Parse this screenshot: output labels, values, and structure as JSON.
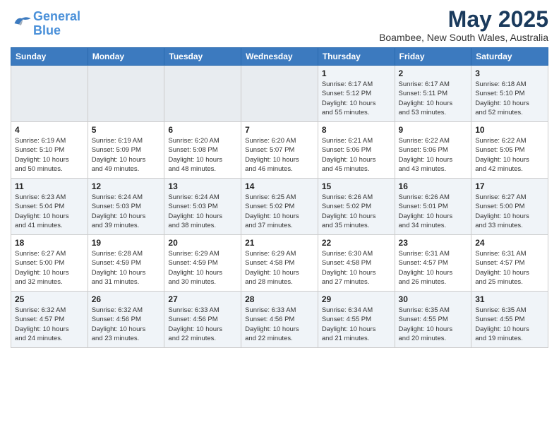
{
  "header": {
    "logo_line1": "General",
    "logo_line2": "Blue",
    "month_title": "May 2025",
    "location": "Boambee, New South Wales, Australia"
  },
  "weekdays": [
    "Sunday",
    "Monday",
    "Tuesday",
    "Wednesday",
    "Thursday",
    "Friday",
    "Saturday"
  ],
  "weeks": [
    [
      {
        "day": "",
        "info": ""
      },
      {
        "day": "",
        "info": ""
      },
      {
        "day": "",
        "info": ""
      },
      {
        "day": "",
        "info": ""
      },
      {
        "day": "1",
        "info": "Sunrise: 6:17 AM\nSunset: 5:12 PM\nDaylight: 10 hours\nand 55 minutes."
      },
      {
        "day": "2",
        "info": "Sunrise: 6:17 AM\nSunset: 5:11 PM\nDaylight: 10 hours\nand 53 minutes."
      },
      {
        "day": "3",
        "info": "Sunrise: 6:18 AM\nSunset: 5:10 PM\nDaylight: 10 hours\nand 52 minutes."
      }
    ],
    [
      {
        "day": "4",
        "info": "Sunrise: 6:19 AM\nSunset: 5:10 PM\nDaylight: 10 hours\nand 50 minutes."
      },
      {
        "day": "5",
        "info": "Sunrise: 6:19 AM\nSunset: 5:09 PM\nDaylight: 10 hours\nand 49 minutes."
      },
      {
        "day": "6",
        "info": "Sunrise: 6:20 AM\nSunset: 5:08 PM\nDaylight: 10 hours\nand 48 minutes."
      },
      {
        "day": "7",
        "info": "Sunrise: 6:20 AM\nSunset: 5:07 PM\nDaylight: 10 hours\nand 46 minutes."
      },
      {
        "day": "8",
        "info": "Sunrise: 6:21 AM\nSunset: 5:06 PM\nDaylight: 10 hours\nand 45 minutes."
      },
      {
        "day": "9",
        "info": "Sunrise: 6:22 AM\nSunset: 5:06 PM\nDaylight: 10 hours\nand 43 minutes."
      },
      {
        "day": "10",
        "info": "Sunrise: 6:22 AM\nSunset: 5:05 PM\nDaylight: 10 hours\nand 42 minutes."
      }
    ],
    [
      {
        "day": "11",
        "info": "Sunrise: 6:23 AM\nSunset: 5:04 PM\nDaylight: 10 hours\nand 41 minutes."
      },
      {
        "day": "12",
        "info": "Sunrise: 6:24 AM\nSunset: 5:03 PM\nDaylight: 10 hours\nand 39 minutes."
      },
      {
        "day": "13",
        "info": "Sunrise: 6:24 AM\nSunset: 5:03 PM\nDaylight: 10 hours\nand 38 minutes."
      },
      {
        "day": "14",
        "info": "Sunrise: 6:25 AM\nSunset: 5:02 PM\nDaylight: 10 hours\nand 37 minutes."
      },
      {
        "day": "15",
        "info": "Sunrise: 6:26 AM\nSunset: 5:02 PM\nDaylight: 10 hours\nand 35 minutes."
      },
      {
        "day": "16",
        "info": "Sunrise: 6:26 AM\nSunset: 5:01 PM\nDaylight: 10 hours\nand 34 minutes."
      },
      {
        "day": "17",
        "info": "Sunrise: 6:27 AM\nSunset: 5:00 PM\nDaylight: 10 hours\nand 33 minutes."
      }
    ],
    [
      {
        "day": "18",
        "info": "Sunrise: 6:27 AM\nSunset: 5:00 PM\nDaylight: 10 hours\nand 32 minutes."
      },
      {
        "day": "19",
        "info": "Sunrise: 6:28 AM\nSunset: 4:59 PM\nDaylight: 10 hours\nand 31 minutes."
      },
      {
        "day": "20",
        "info": "Sunrise: 6:29 AM\nSunset: 4:59 PM\nDaylight: 10 hours\nand 30 minutes."
      },
      {
        "day": "21",
        "info": "Sunrise: 6:29 AM\nSunset: 4:58 PM\nDaylight: 10 hours\nand 28 minutes."
      },
      {
        "day": "22",
        "info": "Sunrise: 6:30 AM\nSunset: 4:58 PM\nDaylight: 10 hours\nand 27 minutes."
      },
      {
        "day": "23",
        "info": "Sunrise: 6:31 AM\nSunset: 4:57 PM\nDaylight: 10 hours\nand 26 minutes."
      },
      {
        "day": "24",
        "info": "Sunrise: 6:31 AM\nSunset: 4:57 PM\nDaylight: 10 hours\nand 25 minutes."
      }
    ],
    [
      {
        "day": "25",
        "info": "Sunrise: 6:32 AM\nSunset: 4:57 PM\nDaylight: 10 hours\nand 24 minutes."
      },
      {
        "day": "26",
        "info": "Sunrise: 6:32 AM\nSunset: 4:56 PM\nDaylight: 10 hours\nand 23 minutes."
      },
      {
        "day": "27",
        "info": "Sunrise: 6:33 AM\nSunset: 4:56 PM\nDaylight: 10 hours\nand 22 minutes."
      },
      {
        "day": "28",
        "info": "Sunrise: 6:33 AM\nSunset: 4:56 PM\nDaylight: 10 hours\nand 22 minutes."
      },
      {
        "day": "29",
        "info": "Sunrise: 6:34 AM\nSunset: 4:55 PM\nDaylight: 10 hours\nand 21 minutes."
      },
      {
        "day": "30",
        "info": "Sunrise: 6:35 AM\nSunset: 4:55 PM\nDaylight: 10 hours\nand 20 minutes."
      },
      {
        "day": "31",
        "info": "Sunrise: 6:35 AM\nSunset: 4:55 PM\nDaylight: 10 hours\nand 19 minutes."
      }
    ]
  ]
}
